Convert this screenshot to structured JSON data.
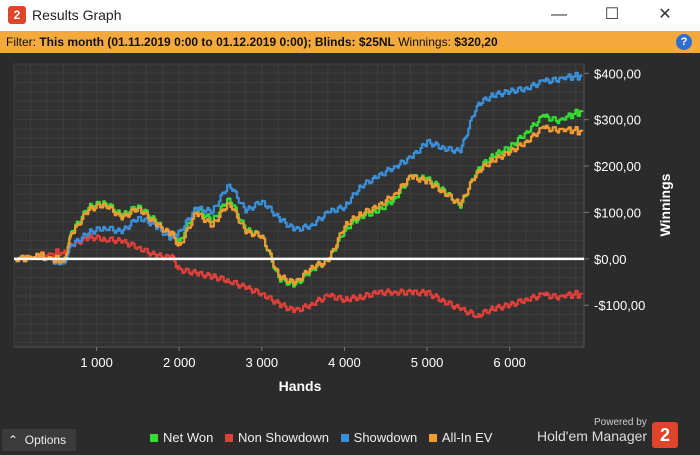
{
  "window": {
    "title": "Results Graph",
    "app_icon_glyph": "2",
    "minimize": "—",
    "maximize": "☐",
    "close": "✕"
  },
  "filter": {
    "prefix": "Filter:",
    "period": "This month (01.11.2019 0:00 to 01.12.2019 0:00);",
    "blinds_label": "Blinds:",
    "blinds_value": "$25NL",
    "winnings_label": "Winnings:",
    "winnings_value": "$320,20",
    "help": "?"
  },
  "colors": {
    "net_won": "#33dd33",
    "non_showdown": "#e0403a",
    "showdown": "#3b8fd8",
    "all_in_ev": "#f39a33",
    "zero_line": "#ffffff",
    "accent": "#f3a93b"
  },
  "chart_data": {
    "type": "line",
    "xlabel": "Hands",
    "ylabel": "Winnings",
    "xlim": [
      0,
      6900
    ],
    "ylim": [
      -190,
      420
    ],
    "x_ticks": [
      "1 000",
      "2 000",
      "3 000",
      "4 000",
      "5 000",
      "6 000"
    ],
    "x_tick_values": [
      1000,
      2000,
      3000,
      4000,
      5000,
      6000
    ],
    "y_ticks": [
      "$400,00",
      "$300,00",
      "$200,00",
      "$100,00",
      "$0,00",
      "-$100,00"
    ],
    "y_tick_values": [
      400,
      300,
      200,
      100,
      0,
      -100
    ],
    "x": [
      0,
      300,
      600,
      700,
      900,
      1100,
      1300,
      1500,
      1700,
      1900,
      2000,
      2200,
      2400,
      2600,
      2800,
      3000,
      3200,
      3400,
      3600,
      3800,
      4000,
      4200,
      4400,
      4600,
      4800,
      5000,
      5200,
      5400,
      5600,
      5800,
      6000,
      6200,
      6400,
      6600,
      6880
    ],
    "series": [
      {
        "name": "Net Won",
        "color_key": "net_won",
        "values": [
          0,
          5,
          -5,
          60,
          110,
          120,
          90,
          115,
          85,
          50,
          40,
          110,
          80,
          130,
          60,
          50,
          -40,
          -55,
          -20,
          -5,
          60,
          90,
          100,
          130,
          180,
          175,
          150,
          110,
          190,
          220,
          240,
          275,
          310,
          300,
          320
        ]
      },
      {
        "name": "Non Showdown",
        "color_key": "non_showdown",
        "values": [
          0,
          5,
          15,
          30,
          45,
          40,
          35,
          25,
          10,
          5,
          -20,
          -30,
          -40,
          -50,
          -65,
          -75,
          -95,
          -110,
          -95,
          -80,
          -90,
          -85,
          -75,
          -70,
          -70,
          -70,
          -90,
          -110,
          -125,
          -110,
          -100,
          -85,
          -75,
          -80,
          -75
        ]
      },
      {
        "name": "Showdown",
        "color_key": "showdown",
        "values": [
          0,
          5,
          -10,
          30,
          55,
          65,
          55,
          90,
          75,
          45,
          60,
          110,
          100,
          160,
          100,
          125,
          90,
          65,
          75,
          100,
          110,
          155,
          175,
          200,
          220,
          255,
          240,
          230,
          330,
          350,
          360,
          370,
          385,
          390,
          395
        ]
      },
      {
        "name": "All-In EV",
        "color_key": "all_in_ev",
        "values": [
          0,
          5,
          -5,
          55,
          105,
          115,
          85,
          110,
          80,
          55,
          30,
          100,
          70,
          120,
          55,
          50,
          -35,
          -50,
          -15,
          -5,
          70,
          95,
          110,
          140,
          180,
          170,
          145,
          115,
          185,
          210,
          230,
          255,
          285,
          280,
          275
        ]
      }
    ]
  },
  "bottom": {
    "options_label": "Options",
    "options_glyph": "⌃",
    "powered_by": "Powered by",
    "brand": "Hold'em Manager",
    "brand_logo": "2"
  }
}
